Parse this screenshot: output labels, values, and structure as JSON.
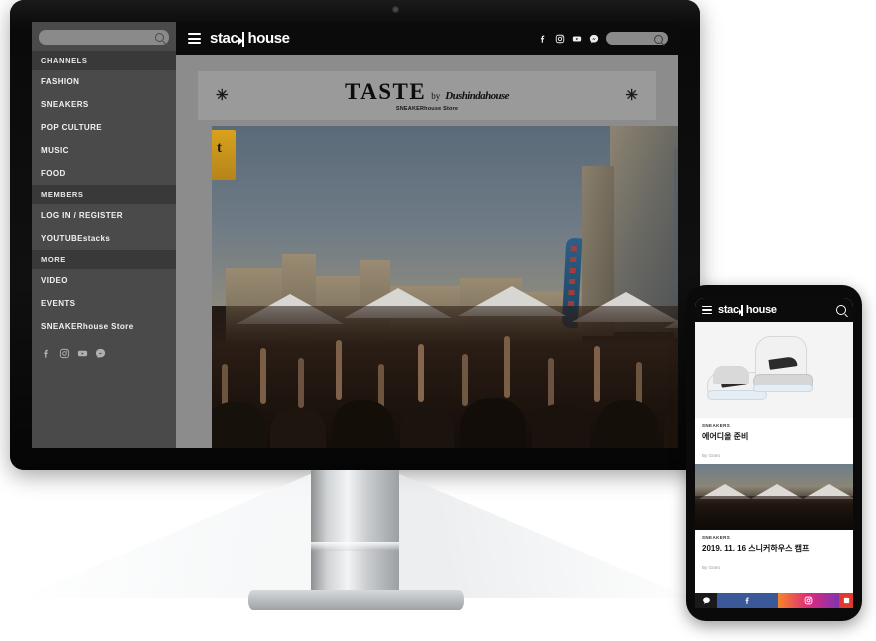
{
  "device": {
    "monitor_name": "desktop-monitor",
    "phone_name": "smartphone"
  },
  "desktop": {
    "sidebar": {
      "search": {
        "value": "",
        "placeholder": "",
        "icon": "search-icon"
      },
      "sections": [
        {
          "header": "CHANNELS",
          "items": [
            "FASHION",
            "SNEAKERS",
            "POP CULTURE",
            "MUSIC",
            "FOOD"
          ]
        },
        {
          "header": "MEMBERS",
          "items": [
            "LOG IN / REGISTER",
            "YOUTUBEstacks"
          ]
        },
        {
          "header": "MORE",
          "items": [
            "VIDEO",
            "EVENTS",
            "SNEAKERhouse Store"
          ]
        }
      ],
      "social": [
        "facebook-icon",
        "instagram-icon",
        "youtube-icon",
        "messenger-icon"
      ]
    },
    "topbar": {
      "menu_icon": "hamburger-icon",
      "brand": {
        "part1": "stac",
        "part2": "house",
        "mark": "k-logo-mark"
      },
      "social": [
        "facebook-icon",
        "instagram-icon",
        "youtube-icon",
        "messenger-icon"
      ],
      "search": {
        "value": "",
        "placeholder": "",
        "icon": "search-icon"
      }
    },
    "banner": {
      "left_mark": "✳",
      "right_mark": "✳",
      "title": "TASTE",
      "by": "by",
      "script": "Dushindahouse",
      "subtitle": "SNEAKERhouse Store"
    },
    "hero": {
      "alt": "crowd-with-raised-hands-at-outdoor-city-event",
      "flag_label": "event-feather-flag",
      "ad_letter": "t"
    }
  },
  "phone": {
    "topbar": {
      "menu_icon": "hamburger-icon",
      "brand": {
        "part1": "stac",
        "part2": "house",
        "mark": "k-logo-mark"
      },
      "search_icon": "search-icon"
    },
    "cards": [
      {
        "image_alt": "white-grey-dior-air-jordan-sneakers",
        "category": "SNEAKERS",
        "title": "에어디올 준비",
        "byline": "By Grant"
      },
      {
        "image_alt": "crowd-at-sneakerhouse-camp-event",
        "category": "SNEAKERS",
        "title": "2019. 11. 16 스니커하우스 캠프",
        "byline": "By Grant"
      }
    ],
    "share_bar": [
      {
        "name": "kakao",
        "icon": "kakao-icon",
        "color": "#1a1a1a"
      },
      {
        "name": "facebook",
        "icon": "facebook-icon",
        "color": "#3b5998"
      },
      {
        "name": "instagram",
        "icon": "instagram-icon",
        "color": "#dd2a7b"
      },
      {
        "name": "more",
        "icon": "more-icon",
        "color": "#e03a2f"
      }
    ]
  },
  "colors": {
    "sidebar_bg": "#4a4a4a",
    "sidebar_header_bg": "#393939",
    "topbar_bg": "#0b0b0b",
    "content_bg": "#8c8c8c",
    "banner_bg": "#9a9a9a",
    "bezel": "#0d0d0d",
    "stand_metal": "#d6d9db"
  }
}
